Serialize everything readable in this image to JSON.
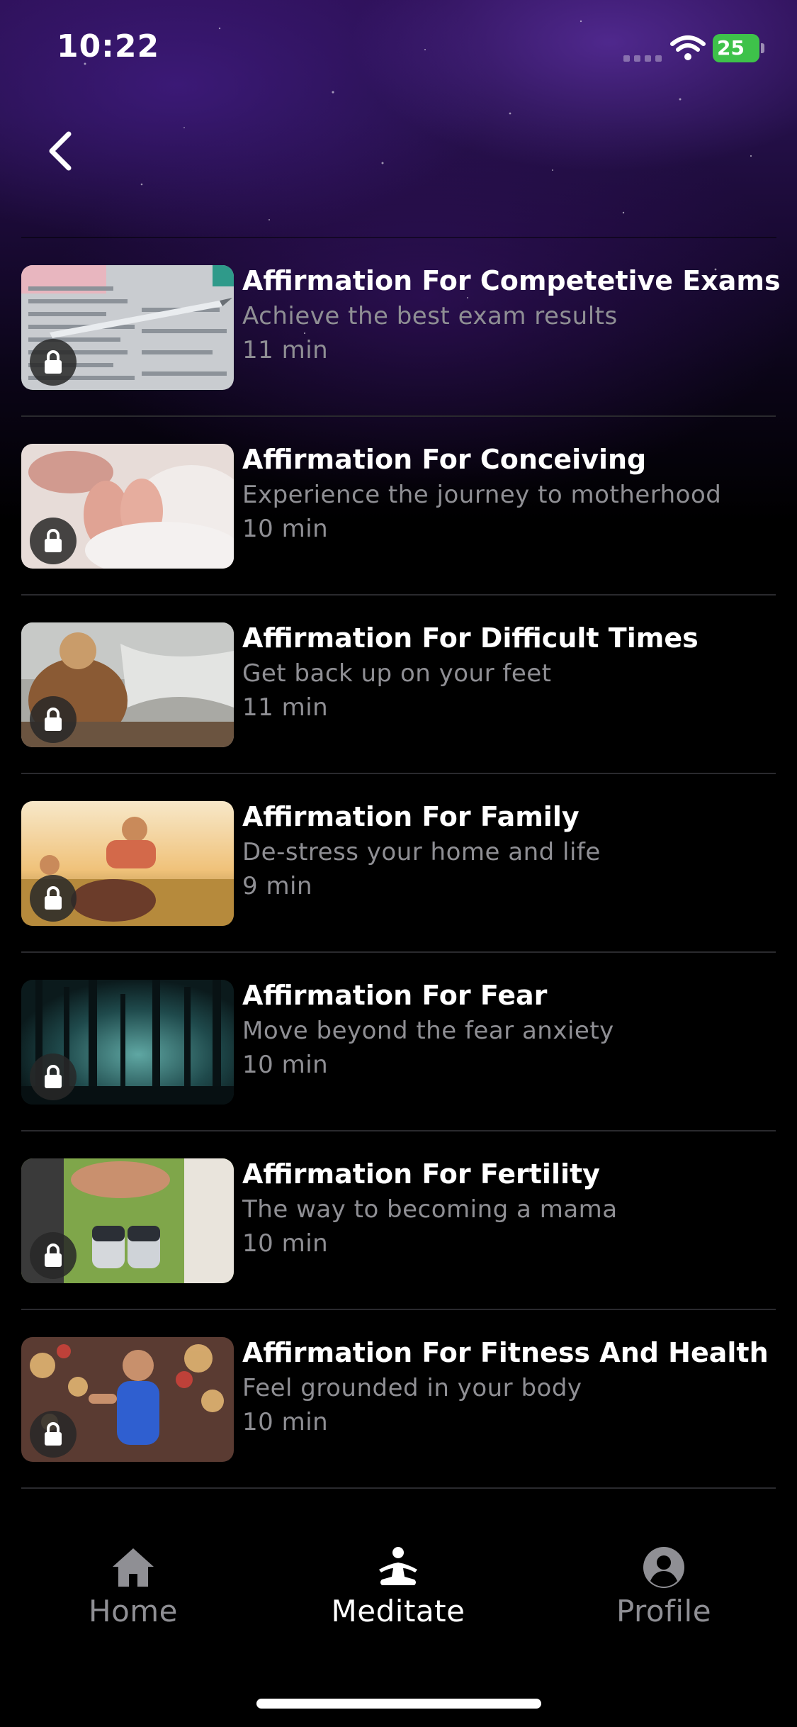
{
  "status_bar": {
    "time": "10:22",
    "battery": "25"
  },
  "colors": {
    "accent_purple": "#2c1055",
    "battery_green": "#3ec24a",
    "subtitle_gray": "#8f8f94"
  },
  "items": [
    {
      "title": "Affirmation For Competetive Exams",
      "subtitle": "Achieve the best exam results",
      "duration": "11 min",
      "icon": "lock-icon"
    },
    {
      "title": "Affirmation For Conceiving",
      "subtitle": "Experience the journey to motherhood",
      "duration": "10 min",
      "icon": "lock-icon"
    },
    {
      "title": "Affirmation For Difficult Times",
      "subtitle": "Get back up on your feet",
      "duration": "11 min",
      "icon": "lock-icon"
    },
    {
      "title": "Affirmation For Family",
      "subtitle": "De-stress your home and life",
      "duration": "9 min",
      "icon": "lock-icon"
    },
    {
      "title": "Affirmation For Fear",
      "subtitle": "Move beyond the fear anxiety",
      "duration": "10 min",
      "icon": "lock-icon"
    },
    {
      "title": "Affirmation For Fertility",
      "subtitle": "The way to becoming a mama",
      "duration": "10 min",
      "icon": "lock-icon"
    },
    {
      "title": "Affirmation For Fitness And Health",
      "subtitle": "Feel grounded in your body",
      "duration": "10 min",
      "icon": "lock-icon"
    }
  ],
  "tabs": [
    {
      "label": "Home",
      "icon": "home-icon",
      "active": false
    },
    {
      "label": "Meditate",
      "icon": "meditate-icon",
      "active": true
    },
    {
      "label": "Profile",
      "icon": "profile-icon",
      "active": false
    }
  ]
}
